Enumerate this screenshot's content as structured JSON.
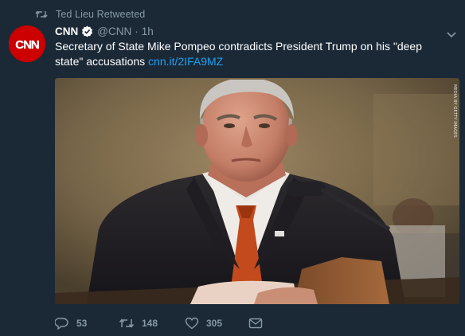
{
  "retweet_context": {
    "label": "Ted Lieu Retweeted",
    "icon": "retweet-icon"
  },
  "author": {
    "name": "CNN",
    "handle": "@CNN",
    "separator": "·",
    "time": "1h",
    "verified": true,
    "avatar_text": "CNN",
    "avatar_color": "#cc0000"
  },
  "tweet": {
    "text": "Secretary of State Mike Pompeo contradicts President Trump on his \"deep state\" accusations",
    "link": "cnn.it/2IFA9MZ"
  },
  "media": {
    "credit": "MEDIA BY GETTY IMAGES"
  },
  "actions": {
    "replies": "53",
    "retweets": "148",
    "likes": "305"
  },
  "colors": {
    "background": "#1b2937",
    "muted": "#8899a6",
    "link": "#1da1f2",
    "verified": "#ffffff"
  }
}
